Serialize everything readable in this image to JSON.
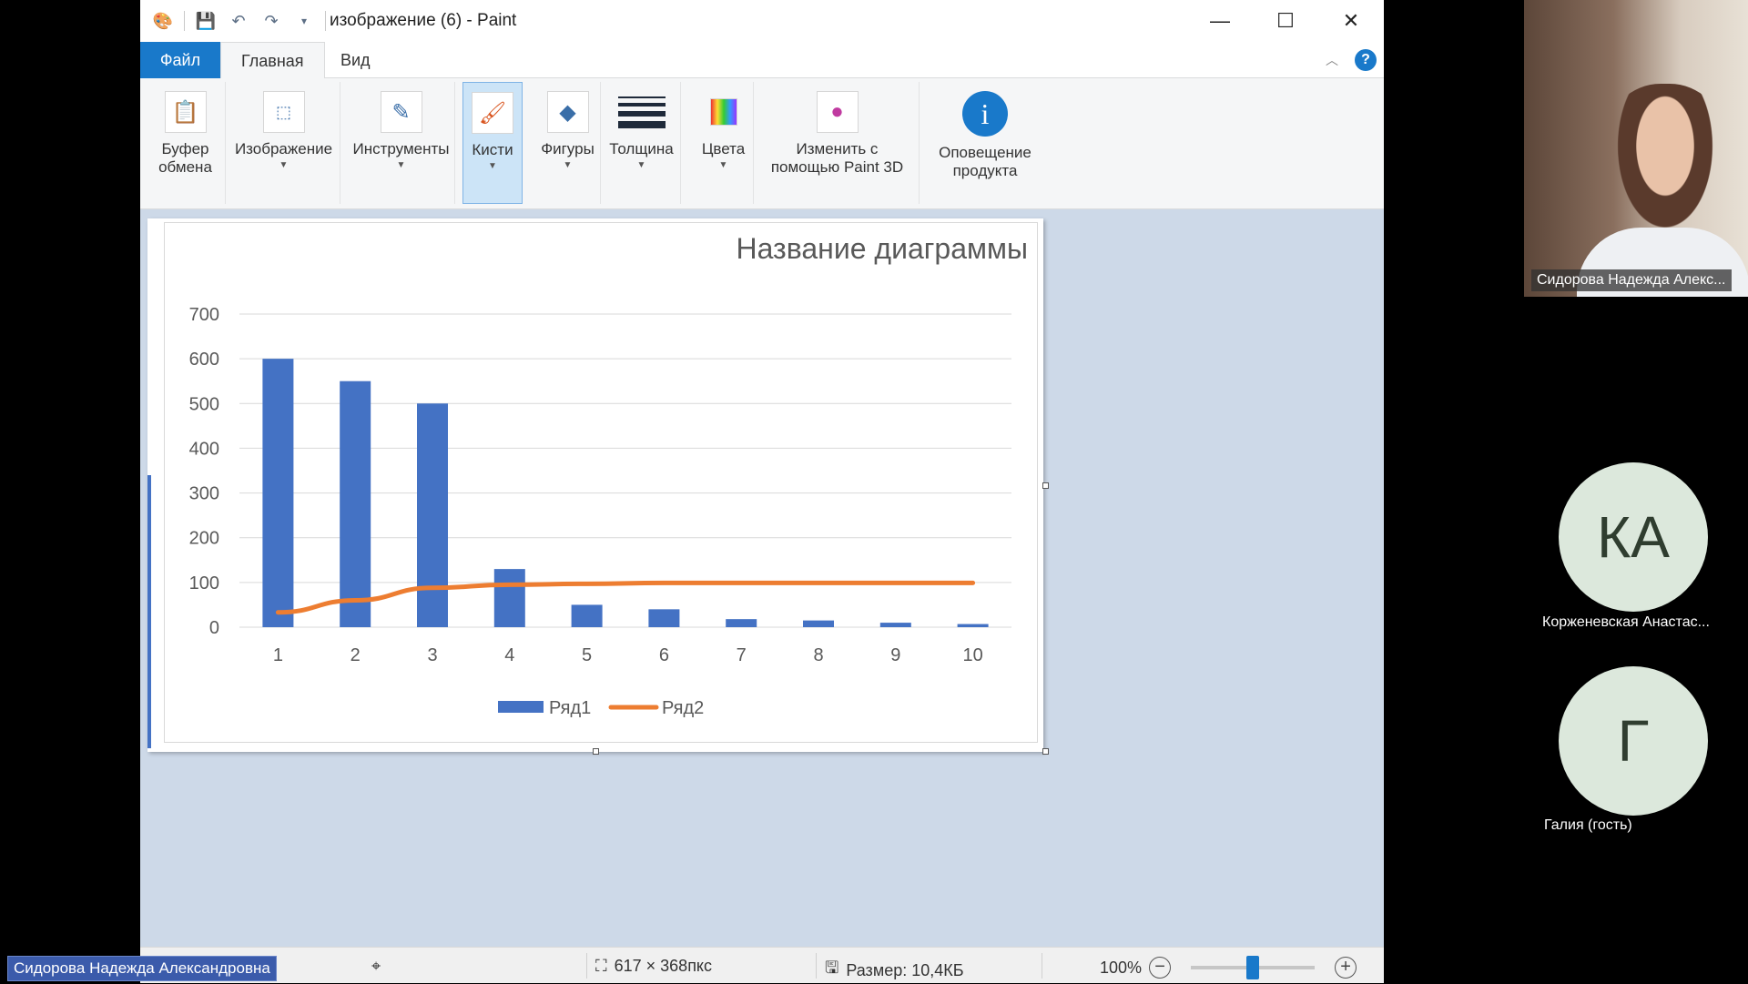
{
  "window": {
    "title": "изображение (6) - Paint",
    "minimize_glyph": "—",
    "maximize_glyph": "☐",
    "close_glyph": "✕"
  },
  "quick_access": [
    "paint-app-icon",
    "save-icon",
    "undo-icon",
    "redo-icon",
    "customize-dropdown-icon"
  ],
  "menu": {
    "file": "Файл",
    "home": "Главная",
    "view": "Вид",
    "help": "?"
  },
  "ribbon": {
    "clipboard": "Буфер\nобмена",
    "image": "Изображение",
    "tools": "Инструменты",
    "brushes": "Кисти",
    "shapes": "Фигуры",
    "thickness": "Толщина",
    "colors": "Цвета",
    "paint3d": "Изменить с\nпомощью Paint 3D",
    "notify": "Оповещение\nпродукта"
  },
  "chart_data": {
    "type": "bar",
    "title": "Название диаграммы",
    "categories": [
      "1",
      "2",
      "3",
      "4",
      "5",
      "6",
      "7",
      "8",
      "9",
      "10"
    ],
    "series": [
      {
        "name": "Ряд1",
        "type": "bar",
        "color": "#4472c4",
        "values": [
          600,
          550,
          500,
          130,
          50,
          40,
          18,
          15,
          10,
          7
        ]
      },
      {
        "name": "Ряд2",
        "type": "line",
        "color": "#ed7d31",
        "values": [
          33,
          60,
          88,
          95,
          97,
          99,
          99,
          99,
          99,
          99
        ]
      }
    ],
    "ylim": [
      0,
      700
    ],
    "yticks": [
      0,
      100,
      200,
      300,
      400,
      500,
      600,
      700
    ],
    "grid": true,
    "legend": "bottom"
  },
  "status": {
    "dimensions": "617 × 368пкс",
    "size": "Размер: 10,4КБ",
    "zoom": "100%",
    "zoom_level": 0.5
  },
  "call": {
    "speaker_name": "Сидорова Надежда Алекс...",
    "participants": [
      {
        "initials": "КА",
        "name": "Корженевская Анастас..."
      },
      {
        "initials": "Г",
        "name": "Галия (гость)"
      }
    ],
    "self_name": "Сидорова Надежда Александровна"
  }
}
